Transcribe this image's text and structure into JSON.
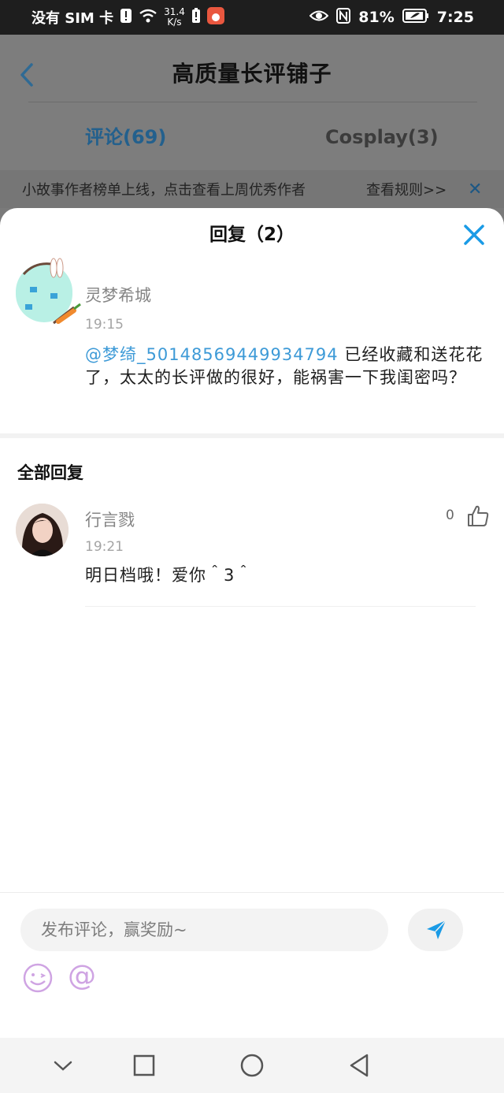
{
  "status_bar": {
    "carrier": "没有 SIM 卡",
    "net_speed_value": "31.4",
    "net_speed_unit": "K/s",
    "battery_percent": "81%",
    "time": "7:25",
    "icons": [
      "sim-alert-icon",
      "wifi-icon",
      "battery-alert-icon",
      "app-notification-icon",
      "eye-icon",
      "nfc-icon",
      "battery-icon"
    ]
  },
  "header": {
    "title": "高质量长评铺子",
    "back_icon": "back-arrow-icon"
  },
  "tabs": [
    {
      "label": "评论(69)",
      "active": true
    },
    {
      "label": "Cosplay(3)",
      "active": false
    }
  ],
  "notice": {
    "text": "小故事作者榜单上线，点击查看上周优秀作者",
    "link": "查看规则>>",
    "close_icon": "close-icon"
  },
  "reply_sheet": {
    "title": "回复（2）",
    "close_icon": "close-icon",
    "original_comment": {
      "username": "灵梦希城",
      "time": "19:15",
      "mention": "@梦绮_50148569449934794",
      "text": " 已经收藏和送花花了，太太的长评做的很好，能祸害一下我闺密吗？"
    },
    "section_title": "全部回复",
    "replies": [
      {
        "username": "行言戮",
        "time": "19:21",
        "text": "明日档哦！爱你＾3＾",
        "likes": "0"
      }
    ]
  },
  "composer": {
    "placeholder": "发布评论，赢奖励~",
    "at_symbol": "@",
    "icons": [
      "send-icon",
      "emoji-icon",
      "at-icon"
    ]
  },
  "nav_bar": {
    "icons": [
      "nav-down-icon",
      "nav-recents-icon",
      "nav-home-icon",
      "nav-back-icon"
    ]
  },
  "colors": {
    "accent": "#1a9be6",
    "mention": "#3d9ad7",
    "overlay": "#7a7a7a",
    "placeholder_bg": "#f3f3f3"
  }
}
